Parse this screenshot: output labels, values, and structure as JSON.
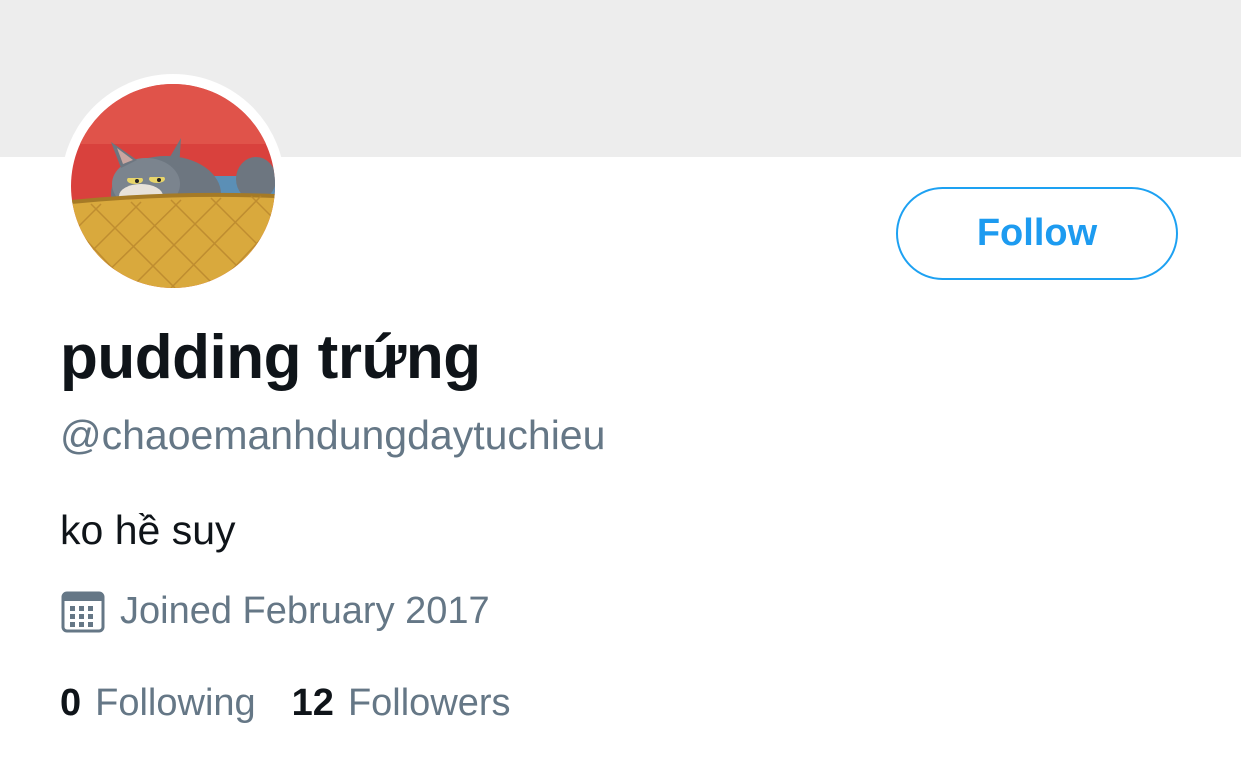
{
  "profile": {
    "display_name": "pudding trứng",
    "handle": "@chaoemanhdungdaytuchieu",
    "bio": "ko hề suy",
    "joined": "Joined February 2017"
  },
  "actions": {
    "follow_label": "Follow"
  },
  "stats": {
    "following_count": "0",
    "following_label": "Following",
    "followers_count": "12",
    "followers_label": "Followers"
  },
  "icons": {
    "joined": "calendar-icon"
  },
  "colors": {
    "accent": "#1da1f2",
    "secondary_text": "#657786",
    "primary_text": "#0f1419",
    "banner": "#ededed"
  }
}
